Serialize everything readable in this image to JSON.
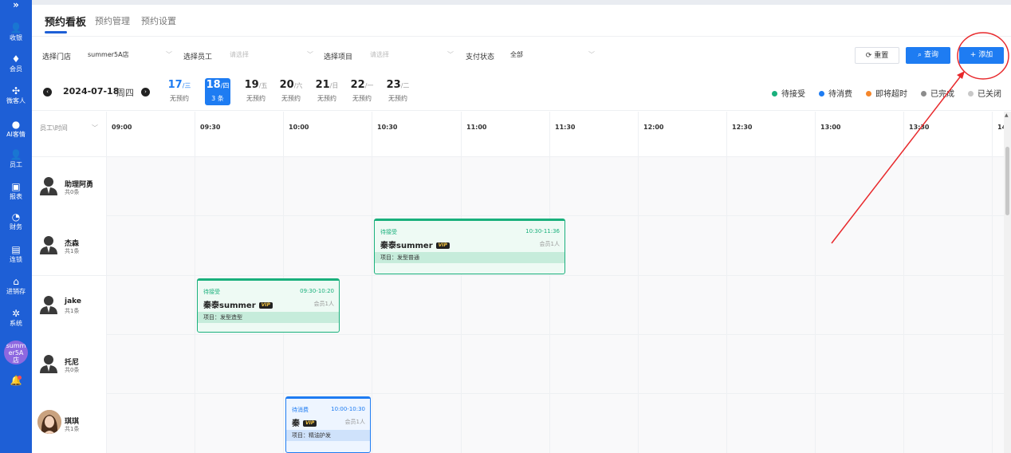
{
  "sidebar": {
    "toggle": "»",
    "items": [
      {
        "icon": "👤",
        "label": "收银"
      },
      {
        "icon": "♦",
        "label": "会员"
      },
      {
        "icon": "✣",
        "label": "微客人"
      },
      {
        "icon": "●",
        "label": "AI客情"
      },
      {
        "icon": "👤",
        "label": "员工"
      },
      {
        "icon": "▣",
        "label": "报表"
      },
      {
        "icon": "◔",
        "label": "财务"
      },
      {
        "icon": "▤",
        "label": "连锁"
      },
      {
        "icon": "⌂",
        "label": "进销存"
      },
      {
        "icon": "✲",
        "label": "系统"
      }
    ],
    "store": "summer5A店",
    "bell": "🔔"
  },
  "tabs": [
    "预约看板",
    "预约管理",
    "预约设置"
  ],
  "filters": {
    "store_label": "选择门店",
    "store_value": "summer5A店",
    "staff_label": "选择员工",
    "staff_placeholder": "请选择",
    "item_label": "选择项目",
    "item_placeholder": "请选择",
    "pay_label": "支付状态",
    "pay_value": "全部",
    "reset": "⟳ 重置",
    "query": "⌕ 查询",
    "add": "+ 添加"
  },
  "datebar": {
    "prev": "‹",
    "next": "›",
    "date": "2024-07-18",
    "weekday": "周四",
    "days": [
      {
        "num": "17",
        "wk": "/三",
        "sub": "无预约"
      },
      {
        "num": "18",
        "wk": "/四",
        "sub": "3 条"
      },
      {
        "num": "19",
        "wk": "/五",
        "sub": "无预约"
      },
      {
        "num": "20",
        "wk": "/六",
        "sub": "无预约"
      },
      {
        "num": "21",
        "wk": "/日",
        "sub": "无预约"
      },
      {
        "num": "22",
        "wk": "/一",
        "sub": "无预约"
      },
      {
        "num": "23",
        "wk": "/二",
        "sub": "无预约"
      }
    ],
    "legend": [
      {
        "label": "待接受",
        "color": "#19b07c"
      },
      {
        "label": "待消费",
        "color": "#1e7cf2"
      },
      {
        "label": "即将超时",
        "color": "#f5862b"
      },
      {
        "label": "已完成",
        "color": "#8c8c8c"
      },
      {
        "label": "已关闭",
        "color": "#c8c8c8"
      }
    ]
  },
  "grid": {
    "corner": "员工\\时间",
    "times": [
      "09:00",
      "09:30",
      "10:00",
      "10:30",
      "11:00",
      "11:30",
      "12:00",
      "12:30",
      "13:00",
      "13:30",
      "14"
    ],
    "staff": [
      {
        "name": "助理阿勇",
        "count": "共0条"
      },
      {
        "name": "杰森",
        "count": "共1条"
      },
      {
        "name": "jake",
        "count": "共1条"
      },
      {
        "name": "托尼",
        "count": "共0条"
      },
      {
        "name": "琪琪",
        "count": "共1条"
      }
    ]
  },
  "appointments": [
    {
      "status": "待接受",
      "time": "10:30-11:36",
      "name": "秦泰summer",
      "vip": "VIP",
      "members": "会员1人",
      "project": "项目：发型普通"
    },
    {
      "status": "待接受",
      "time": "09:30-10:20",
      "name": "秦泰summer",
      "vip": "VIP",
      "members": "会员1人",
      "project": "项目：发型造型"
    },
    {
      "status": "待消费",
      "time": "10:00-10:30",
      "name": "秦",
      "vip": "VIP",
      "members": "会员1人",
      "project": "项目：精油护发"
    }
  ],
  "colors": {
    "sidebar": "#1e5fd6",
    "primary": "#1e7cf2",
    "pending_accept": "#19b07c",
    "pending_consume": "#1e7cf2",
    "annotation": "#e8292c"
  }
}
